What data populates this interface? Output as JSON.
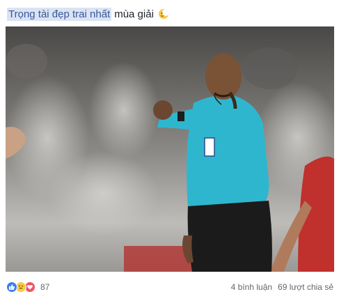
{
  "post": {
    "highlight_text": "Trọng tài đẹp trai nhất",
    "rest_text": "mùa giải",
    "emoji": "moon-face-emoji"
  },
  "reactions": {
    "icons": [
      "like",
      "haha",
      "love"
    ],
    "count": "87"
  },
  "stats": {
    "comments": "4 bình luận",
    "shares": "69 lượt chia sẻ"
  },
  "colors": {
    "highlight_bg": "#dbe3f3",
    "jersey": "#2fb6cf",
    "like": "#3b7df5",
    "love": "#f25268",
    "haha": "#f7c943"
  }
}
